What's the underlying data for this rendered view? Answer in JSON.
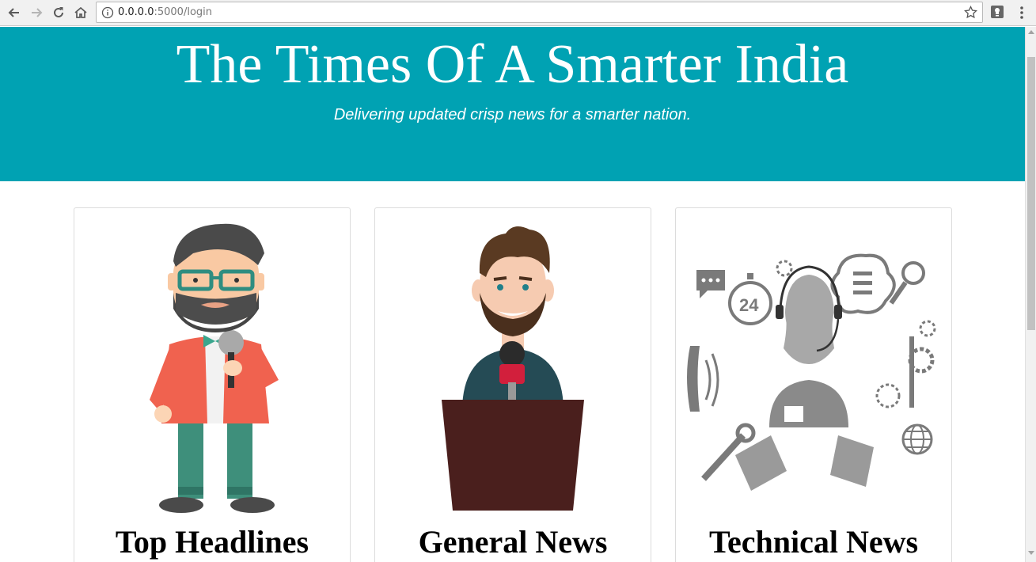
{
  "browser": {
    "url_host": "0.0.0.0",
    "url_path": ":5000/login"
  },
  "hero": {
    "title": "The Times Of A Smarter India",
    "tagline": "Delivering updated crisp news for a smarter nation."
  },
  "cards": [
    {
      "title": "Top Headlines",
      "image": "bearded-reporter-with-microphone"
    },
    {
      "title": "General News",
      "image": "news-anchor-at-podium"
    },
    {
      "title": "Technical News",
      "image": "tech-support-operator-icons"
    }
  ],
  "colors": {
    "hero_bg": "#00a2b3",
    "hero_text": "#ffffff"
  }
}
